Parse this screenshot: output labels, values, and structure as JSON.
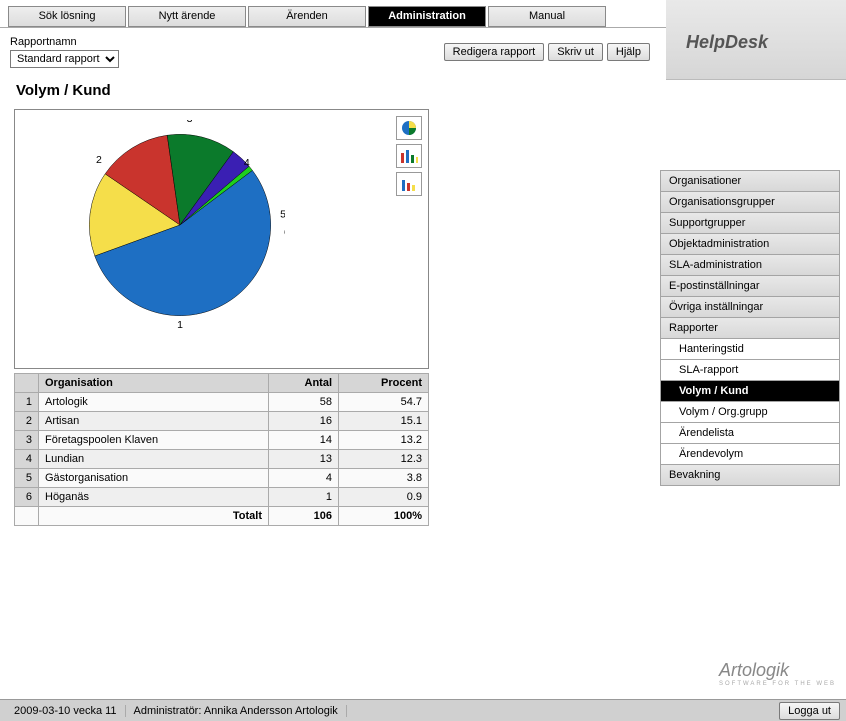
{
  "tabs": {
    "sok": "Sök lösning",
    "nytt": "Nytt ärende",
    "arenden": "Ärenden",
    "admin": "Administration",
    "manual": "Manual"
  },
  "brand": "HelpDesk",
  "report_name_label": "Rapportnamn",
  "report_name_value": "Standard rapport",
  "buttons": {
    "edit": "Redigera rapport",
    "print": "Skriv ut",
    "help": "Hjälp",
    "logout": "Logga ut"
  },
  "report_title": "Volym / Kund",
  "table": {
    "col_org": "Organisation",
    "col_count": "Antal",
    "col_pct": "Procent",
    "rows": [
      {
        "n": "1",
        "org": "Artologik",
        "count": "58",
        "pct": "54.7"
      },
      {
        "n": "2",
        "org": "Artisan",
        "count": "16",
        "pct": "15.1"
      },
      {
        "n": "3",
        "org": "Företagspoolen Klaven",
        "count": "14",
        "pct": "13.2"
      },
      {
        "n": "4",
        "org": "Lundian",
        "count": "13",
        "pct": "12.3"
      },
      {
        "n": "5",
        "org": "Gästorganisation",
        "count": "4",
        "pct": "3.8"
      },
      {
        "n": "6",
        "org": "Höganäs",
        "count": "1",
        "pct": "0.9"
      }
    ],
    "total_label": "Totalt",
    "total_count": "106",
    "total_pct": "100%"
  },
  "sidenav": {
    "items": [
      {
        "label": "Organisationer",
        "sub": false,
        "active": false
      },
      {
        "label": "Organisationsgrupper",
        "sub": false,
        "active": false
      },
      {
        "label": "Supportgrupper",
        "sub": false,
        "active": false
      },
      {
        "label": "Objektadministration",
        "sub": false,
        "active": false
      },
      {
        "label": "SLA-administration",
        "sub": false,
        "active": false
      },
      {
        "label": "E-postinställningar",
        "sub": false,
        "active": false
      },
      {
        "label": "Övriga inställningar",
        "sub": false,
        "active": false
      },
      {
        "label": "Rapporter",
        "sub": false,
        "active": false
      },
      {
        "label": "Hanteringstid",
        "sub": true,
        "active": false
      },
      {
        "label": "SLA-rapport",
        "sub": true,
        "active": false
      },
      {
        "label": "Volym / Kund",
        "sub": true,
        "active": true
      },
      {
        "label": "Volym / Org.grupp",
        "sub": true,
        "active": false
      },
      {
        "label": "Ärendelista",
        "sub": true,
        "active": false
      },
      {
        "label": "Ärendevolym",
        "sub": true,
        "active": false
      },
      {
        "label": "Bevakning",
        "sub": false,
        "active": false
      }
    ]
  },
  "brand_footer": "Artologik",
  "brand_footer_sub": "SOFTWARE FOR THE WEB",
  "status": {
    "date": "2009-03-10  vecka 11",
    "user": "Administratör: Annika Andersson  Artologik"
  },
  "chart_data": {
    "type": "pie",
    "title": "Volym / Kund",
    "series": [
      {
        "name": "Artologik",
        "value": 58,
        "pct": 54.7,
        "color": "#1e6fc3"
      },
      {
        "name": "Artisan",
        "value": 16,
        "pct": 15.1,
        "color": "#f5de4a"
      },
      {
        "name": "Företagspoolen Klaven",
        "value": 14,
        "pct": 13.2,
        "color": "#c9342d"
      },
      {
        "name": "Lundian",
        "value": 13,
        "pct": 12.3,
        "color": "#0b7a2b"
      },
      {
        "name": "Gästorganisation",
        "value": 4,
        "pct": 3.8,
        "color": "#3a1fb3"
      },
      {
        "name": "Höganäs",
        "value": 1,
        "pct": 0.9,
        "color": "#1ecf1e"
      }
    ]
  }
}
